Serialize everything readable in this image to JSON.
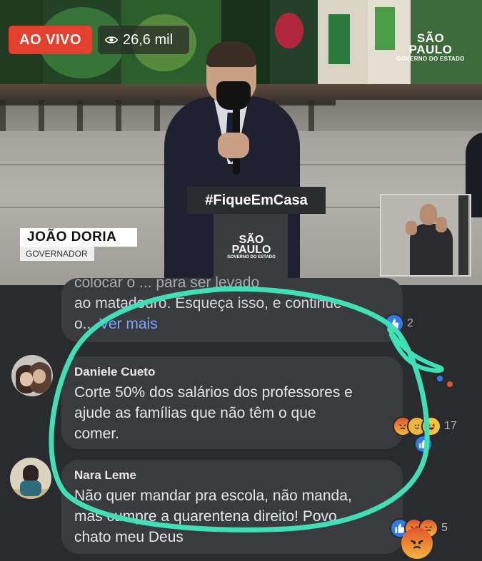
{
  "video": {
    "live_label": "AO VIVO",
    "views": "26,6 mil",
    "logo": {
      "line1": "SÃO PAULO",
      "line2": "GOVERNO DO ESTADO"
    },
    "podium_text": "#FiqueEmCasa",
    "lower_third": {
      "name": "JOÃO DORIA",
      "title": "GOVERNADOR"
    }
  },
  "comments": [
    {
      "author": "",
      "text_faded": "colocar o ... para ser levado",
      "text": "ao matadouro. Esqueça isso, e continue",
      "text3": "o...",
      "more": "Ver mais",
      "reaction_count": "2"
    },
    {
      "author": "Daniele Cueto",
      "lines": [
        "Corte 50% dos salários dos professores e",
        "ajude as famílias que não têm o que",
        "comer."
      ],
      "reaction_count": "17"
    },
    {
      "author": "Nara Leme",
      "lines": [
        "Não quer mandar pra escola, não manda,",
        "mas cumpre a quarentena direito! Povo",
        "chato meu Deus"
      ],
      "reaction_count": "5"
    }
  ],
  "icons": {
    "eye": "eye-icon",
    "like": "thumbs-up-icon",
    "angry": "angry-face-icon",
    "haha": "laughing-face-icon"
  },
  "colors": {
    "live": "#e4402f",
    "highlight": "#3fe0b5",
    "link": "#7aa7ff",
    "bubble": "#3a3b3e"
  }
}
